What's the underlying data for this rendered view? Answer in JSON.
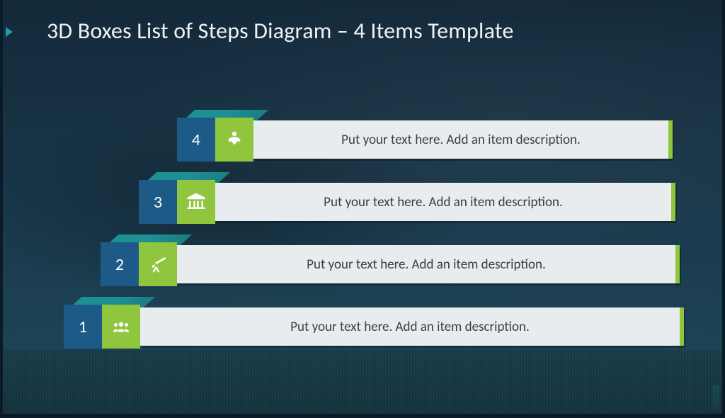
{
  "title": "3D Boxes List of Steps Diagram – 4 Items Template",
  "steps": [
    {
      "number": "1",
      "icon": "people-icon",
      "description": "Put your text here. Add an item description."
    },
    {
      "number": "2",
      "icon": "telescope-icon",
      "description": "Put your text here. Add an item description."
    },
    {
      "number": "3",
      "icon": "bank-icon",
      "description": "Put your text here. Add an item description."
    },
    {
      "number": "4",
      "icon": "care-icon",
      "description": "Put your text here. Add an item description."
    }
  ],
  "colors": {
    "cube_top": "#1e8f95",
    "cube_number_face": "#1d5a87",
    "cube_icon_face": "#8fc63d",
    "bar_bg": "#e8ecef",
    "bar_accent": "#8fc63d",
    "text": "#374048",
    "title": "#eef2f4"
  }
}
